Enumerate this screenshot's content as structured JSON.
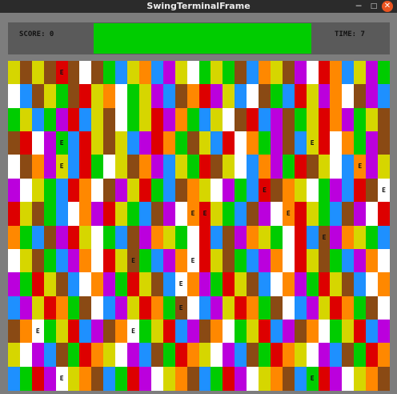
{
  "window": {
    "title": "SwingTerminalFrame",
    "min_glyph": "─",
    "max_glyph": "□",
    "close_glyph": "✕"
  },
  "hud": {
    "score_text": "SCORE: 0",
    "time_text": "TIME:  7",
    "bar_color": "#00cc00",
    "bar_level": 1.0
  },
  "board": {
    "cols": 32,
    "rows": 14,
    "marker": "E",
    "palette": {
      "Y": "#d6d600",
      "N": "#8a4a14",
      "R": "#dd0000",
      "W": "#ffffff",
      "O": "#ff8800",
      "B": "#1e90ff",
      "G": "#00cc00",
      "P": "#bb00dd"
    },
    "grid": [
      "YNYNRNWNGBYOBPYWGYGNBOYNPWROBYPG",
      "WBNYGNRYOWGYPBNORPYBWNGBRYPOWNPB",
      "GYBGPRBYNWGYRPOGBYWNRBPNGYROPGYN",
      "NRWPGBRYNYBPROGNYBRWOGPNBYRWOGPN",
      "WNOPYBRGWYNOPBYGRNYWBOPGRNYWBOPY",
      "PWYGBROWNPYRGBNOYWPGBRNOYWGPBRNW",
      "RYNGBWOPRYGBNPWORYGBNPWORYGBNPWR",
      "OGBNPRYWGBNPOYGWRBNPOYGWRBNPOYGB",
      "WYNGBPOWRYNGBPOWRYNGBPOWRYNGBPOW",
      "PGRYNBWOPGRYNBWOPGRYNBWOPGRYNBWO",
      "BPYROGNWBPYROGNWBPYROGNWBPYROGNW",
      "NOWGYRBPNOWGYRBPNOWGYRBPNOWGYRBP",
      "YWPBNGROYWPBNGROYWPBNGROYWPBNGRO",
      "BGRPWYONBGRPWYONBGRPWYONBGRPWYON"
    ],
    "marks": [
      [
        0,
        4
      ],
      [
        3,
        4
      ],
      [
        4,
        4
      ],
      [
        3,
        25
      ],
      [
        4,
        29
      ],
      [
        5,
        31
      ],
      [
        5,
        21
      ],
      [
        6,
        15
      ],
      [
        6,
        23
      ],
      [
        7,
        26
      ],
      [
        6,
        16
      ],
      [
        8,
        15
      ],
      [
        8,
        10
      ],
      [
        9,
        14
      ],
      [
        10,
        14
      ],
      [
        11,
        10
      ],
      [
        11,
        2
      ],
      [
        13,
        4
      ],
      [
        13,
        25
      ]
    ]
  }
}
